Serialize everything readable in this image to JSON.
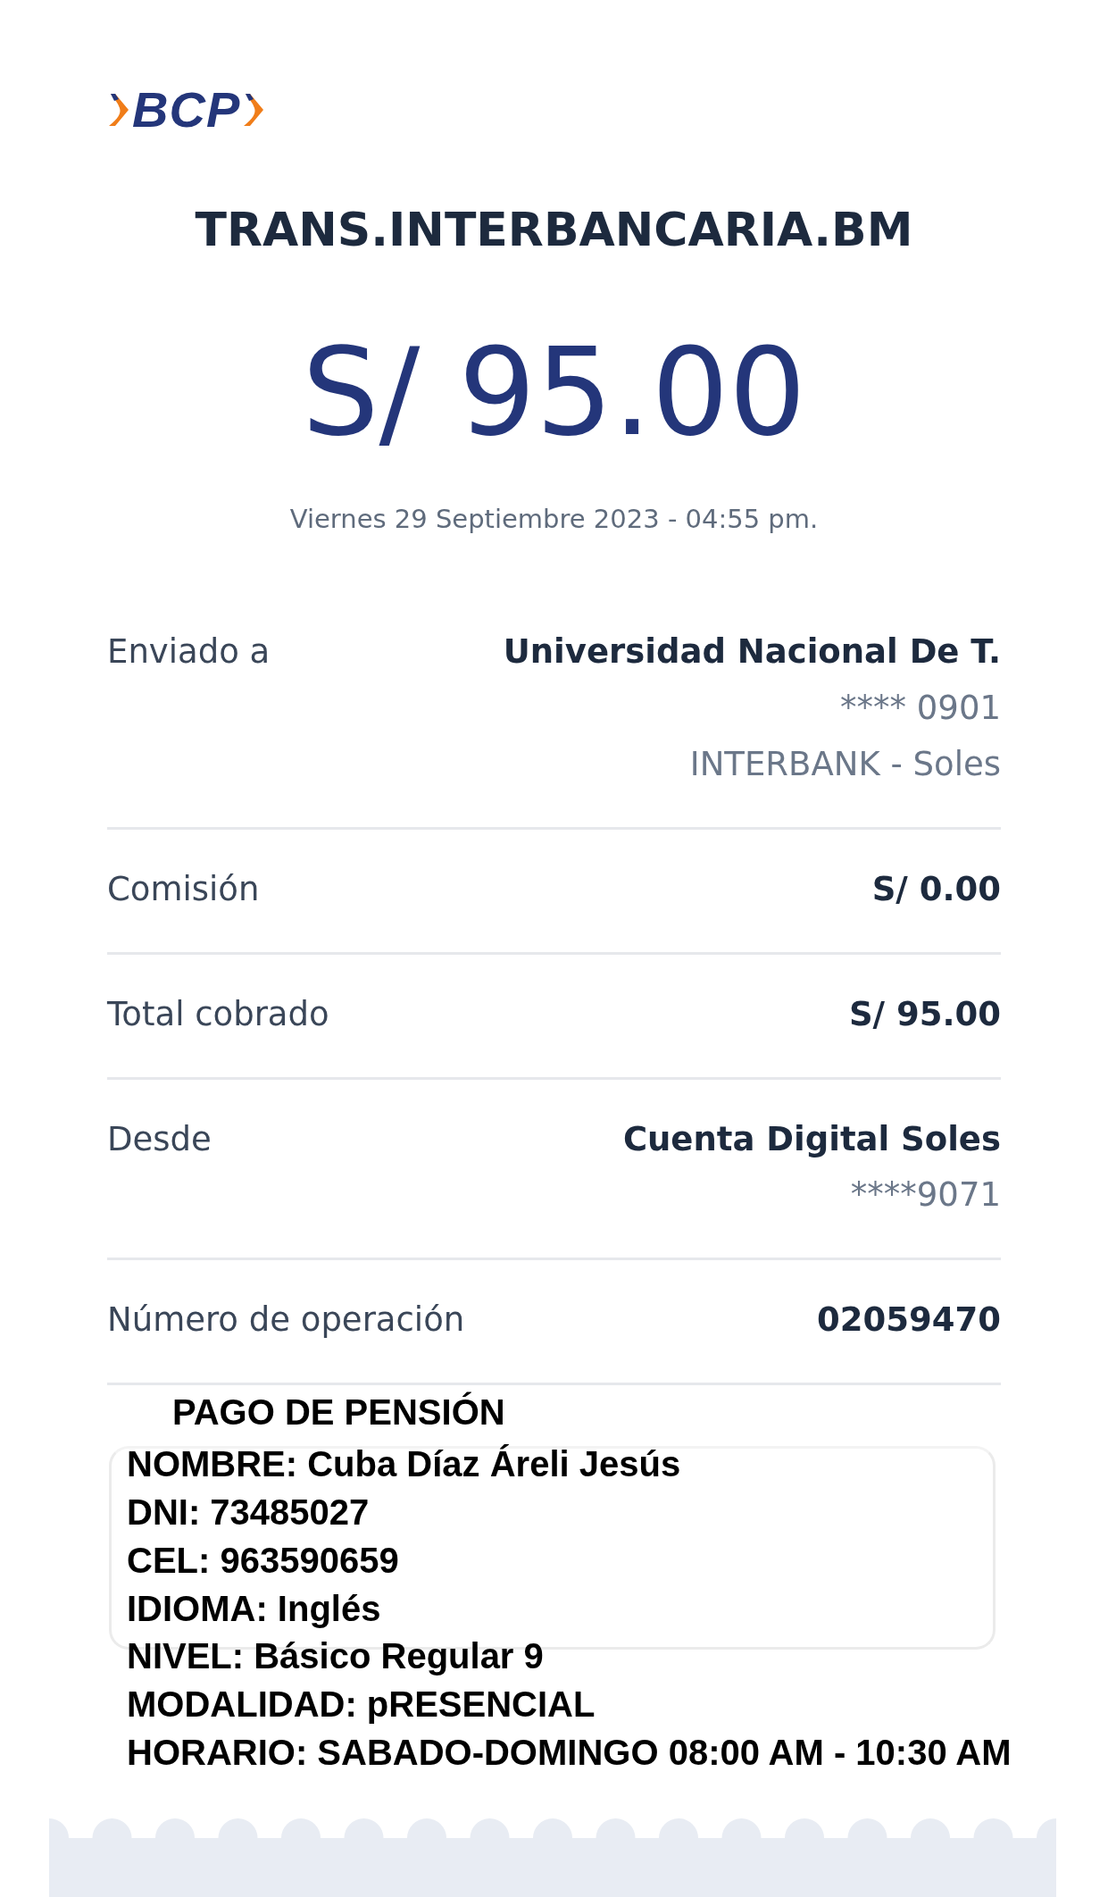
{
  "logo": {
    "text": "BCP"
  },
  "title": "TRANS.INTERBANCARIA.BM",
  "amount": "S/ 95.00",
  "date": "Viernes 29 Septiembre 2023 - 04:55 pm.",
  "rows": [
    {
      "label": "Enviado a",
      "value": "Universidad Nacional De T.",
      "details": [
        "**** 0901",
        "INTERBANK - Soles"
      ]
    },
    {
      "label": "Comisión",
      "value": "S/ 0.00",
      "details": []
    },
    {
      "label": "Total cobrado",
      "value": "S/ 95.00",
      "details": []
    },
    {
      "label": "Desde",
      "value": "Cuenta Digital Soles",
      "details": [
        "****9071"
      ]
    },
    {
      "label": "Número de operación",
      "value": "02059470",
      "details": []
    }
  ],
  "note": {
    "title": "PAGO DE PENSIÓN",
    "lines": [
      "NOMBRE: Cuba Díaz Áreli Jesús",
      "DNI: 73485027",
      "CEL: 963590659",
      "IDIOMA: Inglés",
      "NIVEL: Básico Regular 9",
      "MODALIDAD: pRESENCIAL",
      "HORARIO: SABADO-DOMINGO 08:00 AM - 10:30 AM"
    ]
  }
}
